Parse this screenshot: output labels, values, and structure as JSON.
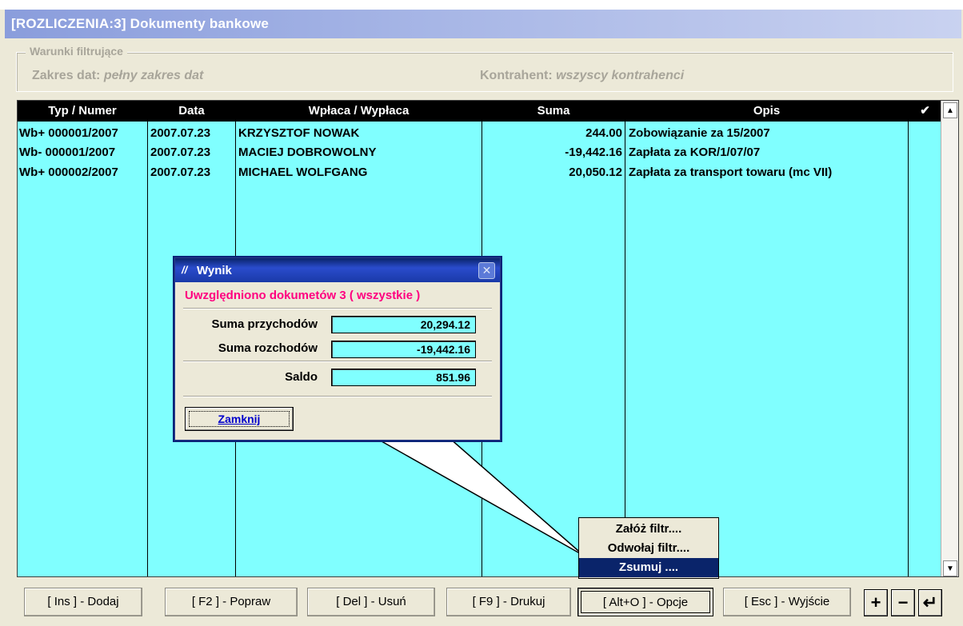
{
  "window": {
    "title": "[ROZLICZENIA:3]  Dokumenty bankowe"
  },
  "filter": {
    "legend": "Warunki filtrujące",
    "date_label": "Zakres dat:",
    "date_value": "pełny zakres dat",
    "contractor_label": "Kontrahent:",
    "contractor_value": "wszyscy kontrahenci"
  },
  "table": {
    "columns": [
      "Typ / Numer",
      "Data",
      "Wpłaca / Wypłaca",
      "Suma",
      "Opis",
      "✔"
    ],
    "rows": [
      {
        "typ": "Wb+ 000001/2007",
        "data": "2007.07.23",
        "party": "KRZYSZTOF NOWAK",
        "suma": "244.00",
        "opis": "Zobowiązanie za 15/2007"
      },
      {
        "typ": "Wb- 000001/2007",
        "data": "2007.07.23",
        "party": "MACIEJ DOBROWOLNY",
        "suma": "-19,442.16",
        "opis": "Zapłata za KOR/1/07/07"
      },
      {
        "typ": "Wb+ 000002/2007",
        "data": "2007.07.23",
        "party": "MICHAEL WOLFGANG",
        "suma": "20,050.12",
        "opis": "Zapłata za transport towaru (mc VII)"
      }
    ]
  },
  "dialog": {
    "title": "Wynik",
    "message": "Uwzględniono dokumetów 3 ( wszystkie )",
    "income_label": "Suma przychodów",
    "income_value": "20,294.12",
    "expense_label": "Suma rozchodów",
    "expense_value": "-19,442.16",
    "balance_label": "Saldo",
    "balance_value": "851.96",
    "close_label": "Zamknij"
  },
  "menu": {
    "items": [
      "Załóż filtr....",
      "Odwołaj filtr....",
      "Zsumuj ...."
    ],
    "selected_index": 2
  },
  "buttons": {
    "add": "[ Ins ] - Dodaj",
    "edit": "[ F2 ] - Popraw",
    "delete": "[ Del ] - Usuń",
    "print": "[ F9 ] - Drukuj",
    "options": "[ Alt+O ] - Opcje",
    "exit": "[ Esc ] - Wyjście",
    "plus": "+",
    "minus": "−",
    "enter": "↵"
  },
  "colors": {
    "grid_bg": "#80ffff",
    "header_bg": "#000000",
    "highlight": "#ff0080",
    "menu_selected": "#0a246a"
  }
}
